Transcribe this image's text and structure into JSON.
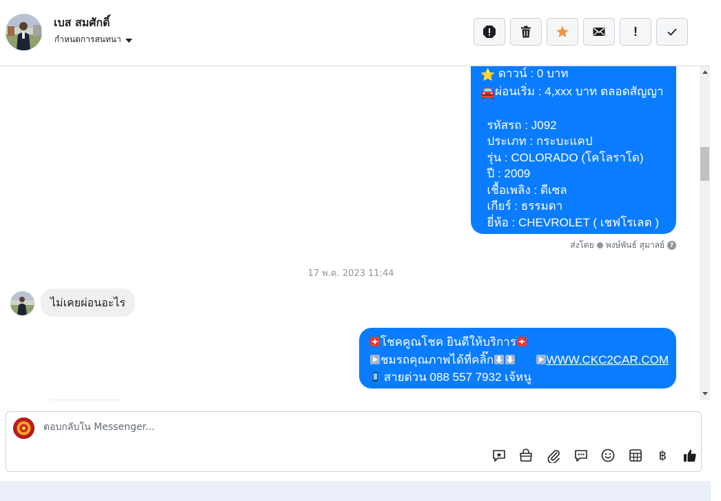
{
  "header": {
    "contact_name": "เบส สมศักดิ์",
    "assign_label": "กำหนดการสนทนา",
    "actions": [
      {
        "name": "spam-button",
        "icon": "stop-exclamation-icon"
      },
      {
        "name": "delete-button",
        "icon": "trash-icon"
      },
      {
        "name": "star-button",
        "icon": "star-icon"
      },
      {
        "name": "mark-unread-button",
        "icon": "envelope-icon"
      },
      {
        "name": "follow-up-button",
        "icon": "exclamation-icon",
        "glyph": "!"
      },
      {
        "name": "done-button",
        "icon": "check-icon"
      }
    ]
  },
  "messages": {
    "bubble1": {
      "line_down_emoji": "⭐",
      "line_down": " ดาวน์ : 0 บาท",
      "line_installment_emoji": "🚘",
      "line_installment": "ผ่อนเริ่ม : 4,xxx บาท ตลอดสัญญา",
      "line_code": "รหัสรถ : J092",
      "line_type": "ประเภท : กระบะแคป",
      "line_model": "รุ่น : COLORADO (โคโลราโด)",
      "line_year": "ปี : 2009",
      "line_fuel": "เชื้อเพลิง : ดีเซล",
      "line_gear": "เกียร์ : ธรรมดา",
      "line_brand": "ยี่ห้อ : CHEVROLET ( เชฟโรเลต )"
    },
    "sent_by_prefix": "ส่งโดย",
    "sent_by_name": "พงษ์พันธ์ สุมาลย์",
    "timestamp": "17 พ.ค. 2023 11:44",
    "incoming_text": "ไม่เคยผ่อนอะไร",
    "bubble2": {
      "line1": "โชคคูณโชค ยินดีให้บริการ",
      "line2_a": "ชมรถคุณภาพได้ที่คลิ๊ก",
      "link": "WWW.CKC2CAR.COM",
      "line3": " สายด่วน 088 557 7932 เจ้หนู"
    }
  },
  "composer": {
    "placeholder": "ตอบกลับใน Messenger...",
    "baht_glyph": "฿",
    "tools": [
      "saved-reply-icon",
      "shop-bag-icon",
      "paperclip-icon",
      "chat-bubble-icon",
      "emoji-icon",
      "table-icon",
      "baht-icon",
      "thumbs-up-icon"
    ]
  },
  "colors": {
    "bubble_out": "#0a7cff",
    "bubble_in": "#f1f0f0",
    "star": "#f7923b"
  }
}
